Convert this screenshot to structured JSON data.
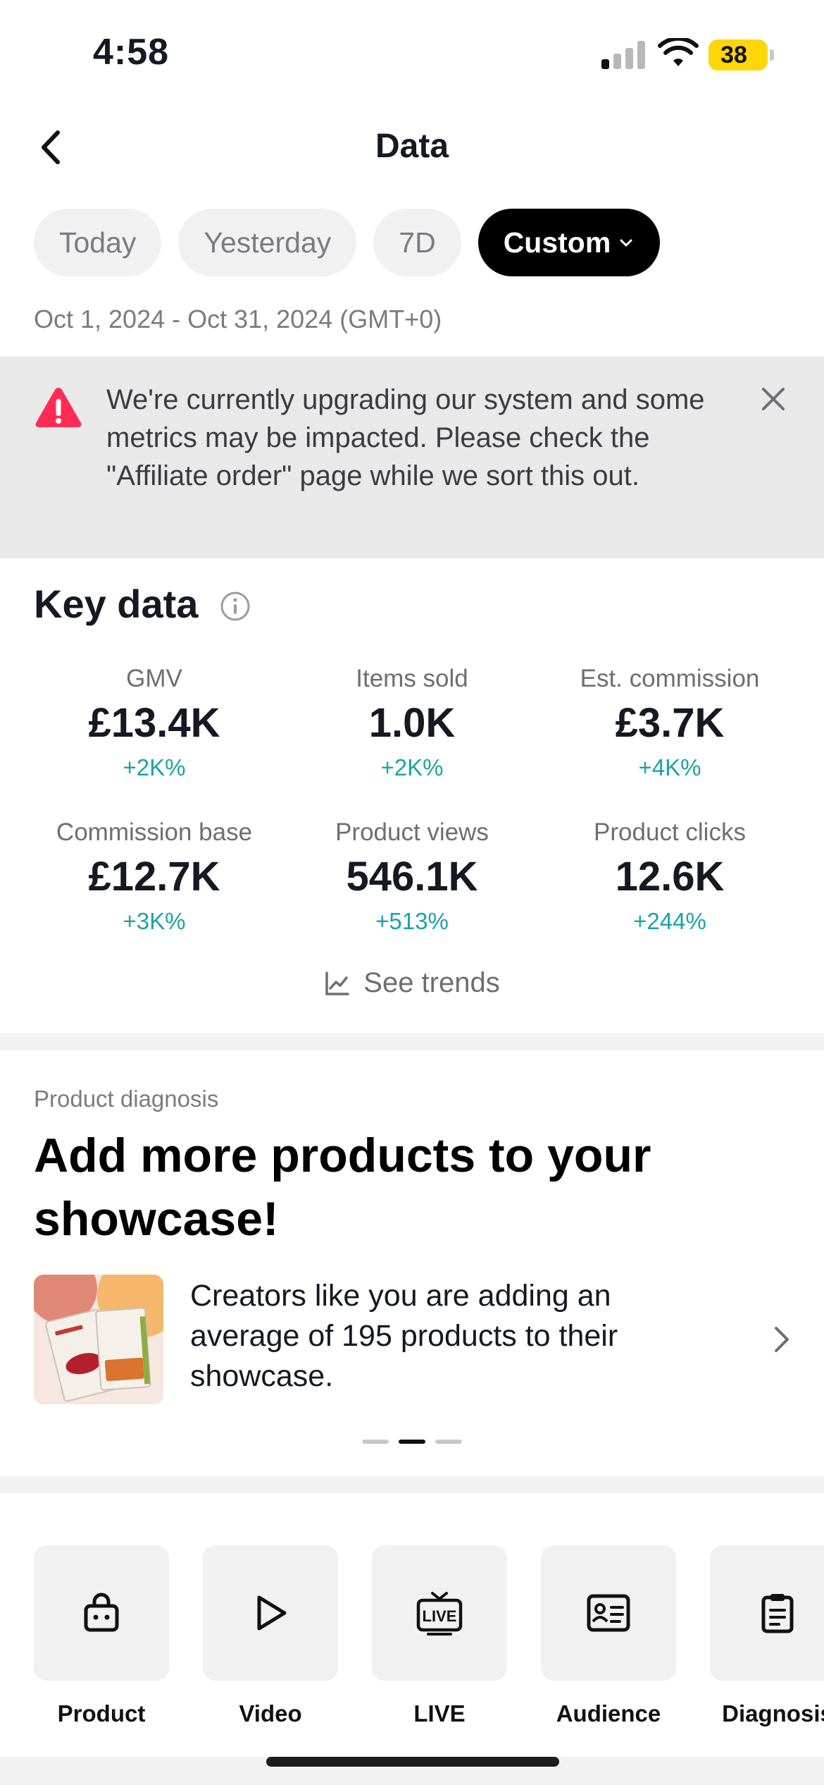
{
  "status_bar": {
    "time": "4:58",
    "battery": "38",
    "battery_color": "#ffd60a"
  },
  "header": {
    "title": "Data",
    "back_icon": "chevron-left-icon",
    "chips": [
      {
        "label": "Today",
        "active": false
      },
      {
        "label": "Yesterday",
        "active": false
      },
      {
        "label": "7D",
        "active": false
      },
      {
        "label": "Custom",
        "active": true
      }
    ],
    "date_range": "Oct 1, 2024 - Oct 31, 2024 (GMT+0)"
  },
  "alert": {
    "icon": "warning-icon",
    "icon_color": "#fe2c55",
    "message": "We're currently upgrading our system and some metrics may be impacted. Please check the \"Affiliate order\" page while we sort this out."
  },
  "key_data": {
    "title": "Key data",
    "metrics": [
      {
        "label": "GMV",
        "value": "£13.4K",
        "delta": "+2K%"
      },
      {
        "label": "Items sold",
        "value": "1.0K",
        "delta": "+2K%"
      },
      {
        "label": "Est. commission",
        "value": "£3.7K",
        "delta": "+4K%"
      },
      {
        "label": "Commission base",
        "value": "£12.7K",
        "delta": "+3K%"
      },
      {
        "label": "Product views",
        "value": "546.1K",
        "delta": "+513%"
      },
      {
        "label": "Product clicks",
        "value": "12.6K",
        "delta": "+244%"
      }
    ],
    "delta_color": "#1aa3a8",
    "see_trends": "See trends"
  },
  "diagnosis": {
    "eyebrow": "Product diagnosis",
    "title": "Add more products to your showcase!",
    "text": "Creators like you are adding an average of 195 products to their showcase.",
    "carousel": {
      "current": 2,
      "total": 3
    }
  },
  "tools": [
    {
      "label": "Product",
      "icon": "shopping-bag-icon"
    },
    {
      "label": "Video",
      "icon": "play-icon"
    },
    {
      "label": "LIVE",
      "icon": "live-tv-icon"
    },
    {
      "label": "Audience",
      "icon": "id-card-icon"
    },
    {
      "label": "Diagnosis",
      "icon": "clipboard-icon"
    }
  ]
}
